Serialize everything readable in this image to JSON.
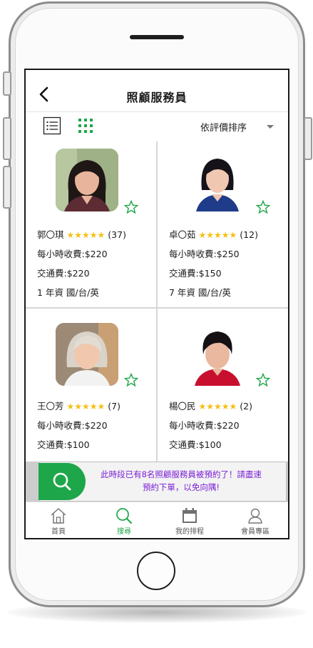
{
  "header": {
    "title": "照顧服務員"
  },
  "toolbar": {
    "sort_label": "依評價排序"
  },
  "caregivers": [
    {
      "name": "郭〇琪",
      "stars": "★★★★★",
      "reviews": "(37)",
      "hourly_fee": "每小時收費:$220",
      "transport_fee": "交通費:$220",
      "experience": "1 年資  國/台/英"
    },
    {
      "name": "卓〇茹",
      "stars": "★★★★★",
      "reviews": "(12)",
      "hourly_fee": "每小時收費:$250",
      "transport_fee": "交通費:$150",
      "experience": "7 年資  國/台/英"
    },
    {
      "name": "王〇芳",
      "stars": "★★★★★",
      "reviews": "(7)",
      "hourly_fee": "每小時收費:$220",
      "transport_fee": "交通費:$100",
      "experience": ""
    },
    {
      "name": "楊〇民",
      "stars": "★★★★★",
      "reviews": "(2)",
      "hourly_fee": "每小時收費:$220",
      "transport_fee": "交通費:$100",
      "experience": ""
    }
  ],
  "banner": {
    "line1": "此時段已有8名照顧服務員被預約了！請盡速",
    "line2": "預約下單，以免向隅!"
  },
  "bottom_nav": [
    {
      "label": "首頁",
      "icon": "home-icon",
      "active": false
    },
    {
      "label": "搜尋",
      "icon": "search-icon",
      "active": true
    },
    {
      "label": "我的排程",
      "icon": "calendar-icon",
      "active": false
    },
    {
      "label": "會員專區",
      "icon": "user-icon",
      "active": false
    }
  ],
  "colors": {
    "accent_green": "#1ea64a",
    "star_yellow": "#f5c014",
    "banner_text": "#7a1ed6"
  }
}
